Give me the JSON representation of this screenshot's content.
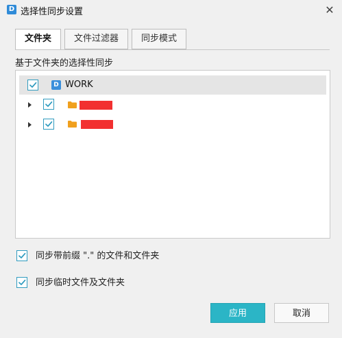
{
  "window": {
    "title": "选择性同步设置",
    "app_icon_text": "D",
    "close_glyph": "✕"
  },
  "tabs": [
    {
      "label": "文件夹",
      "active": true
    },
    {
      "label": "文件过滤器",
      "active": false
    },
    {
      "label": "同步模式",
      "active": false
    }
  ],
  "section_label": "基于文件夹的选择性同步",
  "tree": {
    "root": {
      "label": "WORK",
      "icon_text": "D",
      "checked": true
    },
    "children": [
      {
        "checked": true,
        "icon": "folder-icon",
        "name_redacted": true
      },
      {
        "checked": true,
        "icon": "folder-icon",
        "name_redacted": true
      }
    ]
  },
  "options": [
    {
      "label": "同步带前缀 \".\" 的文件和文件夹",
      "checked": true
    },
    {
      "label": "同步临时文件及文件夹",
      "checked": true
    }
  ],
  "buttons": {
    "apply": "应用",
    "cancel": "取消"
  },
  "colors": {
    "accent": "#2bb5c6",
    "checkbox_border": "#2f9bbf",
    "folder": "#f0a01e",
    "redaction": "#f23030",
    "app_icon": "#2f8bd8"
  }
}
